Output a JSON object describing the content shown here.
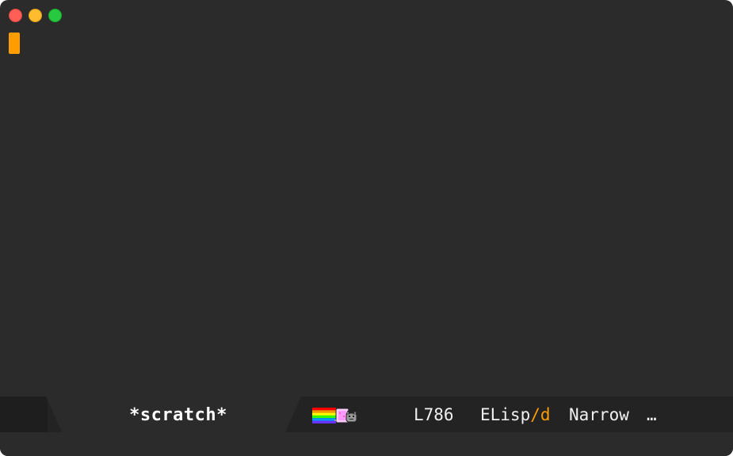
{
  "window": {
    "background": "#2b2b2b",
    "traffic_lights": [
      "close",
      "minimize",
      "maximize"
    ]
  },
  "editor": {
    "cursor_color": "#ff9d00"
  },
  "modeline": {
    "buffer_name": "*scratch*",
    "nyan_icon": "nyan-cat-icon",
    "line_number": "L786",
    "major_mode": "ELisp",
    "mode_separator": "/",
    "mode_suffix": "d",
    "minor_mode": "Narrow",
    "ellipsis": "…",
    "accent_color": "#ff9d00"
  }
}
